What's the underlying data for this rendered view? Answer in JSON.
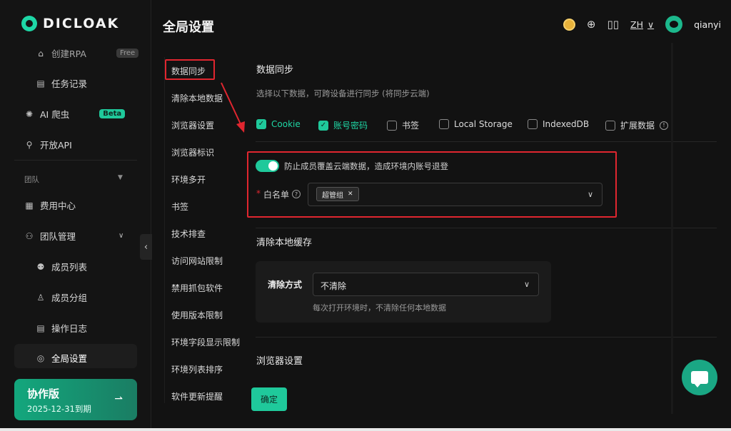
{
  "brand": {
    "name": "DICLOAK"
  },
  "sidebar": {
    "items": [
      {
        "label": "创建RPA",
        "badge": "Free"
      },
      {
        "label": "任务记录"
      },
      {
        "label": "AI 爬虫",
        "badge": "Beta"
      },
      {
        "label": "开放API"
      }
    ],
    "team_section": "团队",
    "team_items": [
      {
        "label": "费用中心"
      },
      {
        "label": "团队管理"
      },
      {
        "label": "成员列表"
      },
      {
        "label": "成员分组"
      },
      {
        "label": "操作日志"
      },
      {
        "label": "全局设置"
      }
    ],
    "plan": {
      "title": "协作版",
      "expiry": "2025-12-31到期"
    }
  },
  "header": {
    "title": "全局设置",
    "lang": "ZH",
    "username": "qianyi"
  },
  "subnav": {
    "items": [
      "数据同步",
      "清除本地数据",
      "浏览器设置",
      "浏览器标识",
      "环境多开",
      "书签",
      "技术排查",
      "访问网站限制",
      "禁用抓包软件",
      "使用版本限制",
      "环境字段显示限制",
      "环境列表排序",
      "软件更新提醒"
    ]
  },
  "sync": {
    "title": "数据同步",
    "desc": "选择以下数据，可跨设备进行同步 (将同步云端)",
    "options": [
      {
        "label": "Cookie",
        "checked": true
      },
      {
        "label": "账号密码",
        "checked": true
      },
      {
        "label": "书签",
        "checked": false
      },
      {
        "label": "Local Storage",
        "checked": false
      },
      {
        "label": "IndexedDB",
        "checked": false
      },
      {
        "label": "扩展数据",
        "checked": false
      }
    ],
    "toggle_label": "防止成员覆盖云端数据，造成环境内账号退登",
    "whitelist_label": "白名单",
    "whitelist_required": "*",
    "whitelist_tag": "超管组"
  },
  "clear": {
    "title": "清除本地缓存",
    "method_label": "清除方式",
    "method_value": "不清除",
    "method_hint": "每次打开环境时，不清除任何本地数据"
  },
  "browser": {
    "title": "浏览器设置"
  },
  "actions": {
    "confirm": "确定"
  },
  "colors": {
    "accent": "#1fc99b",
    "highlight": "#e0262f"
  }
}
